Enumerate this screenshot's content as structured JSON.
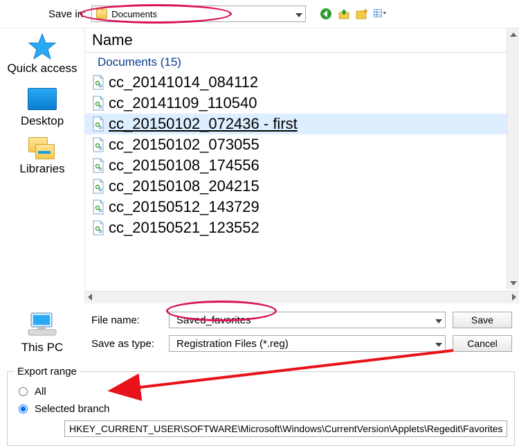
{
  "topbar": {
    "save_in_label": "Save in:",
    "save_in_value": "Documents"
  },
  "sidebar": {
    "items": [
      {
        "label": "Quick access"
      },
      {
        "label": "Desktop"
      },
      {
        "label": "Libraries"
      },
      {
        "label": "This PC"
      }
    ]
  },
  "listing": {
    "header": "Name",
    "group": "Documents (15)",
    "files": [
      "cc_20141014_084112",
      "cc_20141109_110540",
      "cc_20150102_072436 - first",
      "cc_20150102_073055",
      "cc_20150108_174556",
      "cc_20150108_204215",
      "cc_20150512_143729",
      "cc_20150521_123552"
    ],
    "selected_index": 2
  },
  "fields": {
    "file_name_label": "File name:",
    "file_name_value": "Saved_favorites",
    "save_as_type_label": "Save as type:",
    "save_as_type_value": "Registration Files (*.reg)"
  },
  "buttons": {
    "save": "Save",
    "cancel": "Cancel"
  },
  "export": {
    "legend": "Export range",
    "all_label": "All",
    "selected_label": "Selected branch",
    "branch_value": "HKEY_CURRENT_USER\\SOFTWARE\\Microsoft\\Windows\\CurrentVersion\\Applets\\Regedit\\Favorites"
  }
}
